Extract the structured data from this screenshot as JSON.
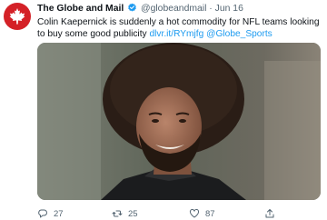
{
  "colors": {
    "brand": "#d42127",
    "link": "#1d9bf0",
    "secondary_text": "#536471",
    "verified": "#1d9bf0"
  },
  "tweet": {
    "author": {
      "name": "The Globe and Mail",
      "handle": "@globeandmail",
      "avatar_icon": "maple-leaf-icon",
      "verified_icon": "verified-badge-icon"
    },
    "separator": "·",
    "date": "Jun 16",
    "text": "Colin Kaepernick is suddenly a hot commodity for NFL teams looking to buy some good publicity",
    "link_text": "dlvr.it/RYmjfg",
    "mention_text": "@Globe_Sports",
    "media": {
      "type": "photo"
    },
    "actions": {
      "reply_icon": "reply-icon",
      "reply_count": "27",
      "retweet_icon": "retweet-icon",
      "retweet_count": "25",
      "like_icon": "heart-icon",
      "like_count": "87",
      "share_icon": "share-icon"
    }
  }
}
